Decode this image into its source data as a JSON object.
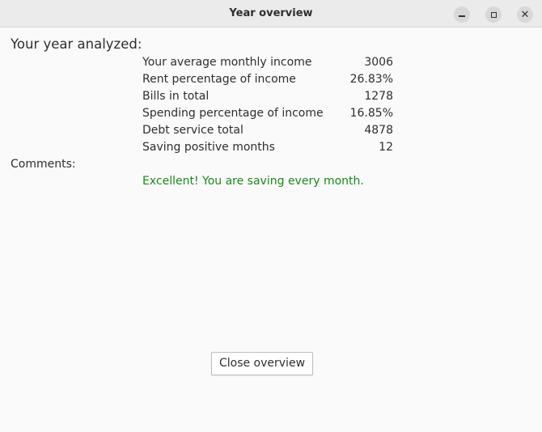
{
  "window": {
    "title": "Year overview",
    "controls": {
      "minimize": "minimize-icon",
      "maximize": "maximize-icon",
      "close": "close-icon"
    }
  },
  "main": {
    "heading": "Your year analyzed:",
    "stats": [
      {
        "label": "Your average monthly income",
        "value": "3006"
      },
      {
        "label": "Rent percentage of income",
        "value": "26.83%"
      },
      {
        "label": "Bills in total",
        "value": "1278"
      },
      {
        "label": "Spending percentage of income",
        "value": "16.85%"
      },
      {
        "label": "Debt service total",
        "value": "4878"
      },
      {
        "label": "Saving positive months",
        "value": "12"
      }
    ],
    "comments_label": "Comments:",
    "comment_text": "Excellent! You are saving every month.",
    "comment_color": "#1a8a1a",
    "close_button_label": "Close overview"
  }
}
